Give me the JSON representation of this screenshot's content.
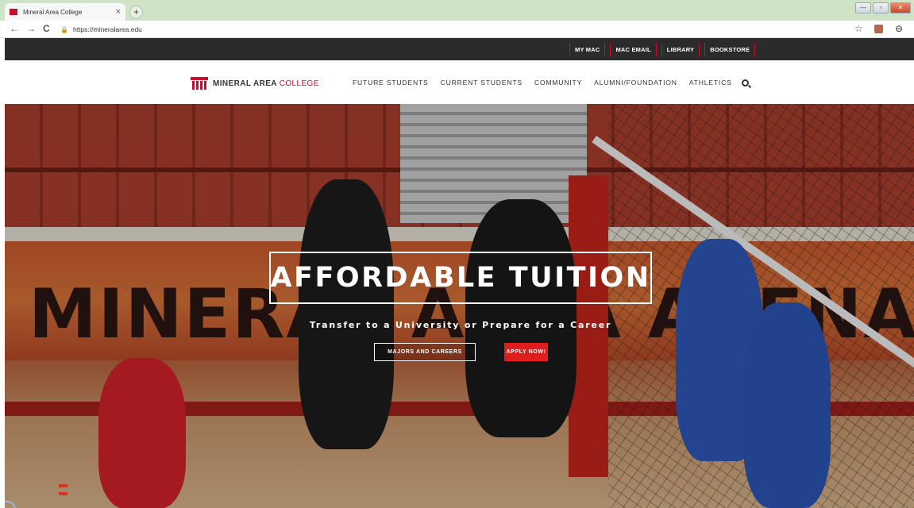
{
  "browser": {
    "tab_title": "Mineral Area College",
    "tab_close": "×",
    "new_tab": "+",
    "url": "https://mineralarea.edu",
    "back": "←",
    "forward": "→",
    "reload": "C",
    "lock": "🔒",
    "star": "☆",
    "account": "⊖",
    "window_min": "—",
    "window_max": "▫",
    "window_close": "✕"
  },
  "utility_nav": {
    "items": [
      "MY MAC",
      "MAC EMAIL",
      "LIBRARY",
      "BOOKSTORE"
    ]
  },
  "header": {
    "logo_primary": "MINERAL AREA",
    "logo_accent": "COLLEGE",
    "nav": [
      "FUTURE STUDENTS",
      "CURRENT STUDENTS",
      "COMMUNITY",
      "ALUMNI/FOUNDATION",
      "ATHLETICS"
    ]
  },
  "hero": {
    "background_text": "MINERAL AREA ARENA",
    "title": "AFFORDABLE TUITION",
    "subtitle": "Transfer to a University or Prepare for a Career",
    "buttons": {
      "majors": "MAJORS AND CAREERS",
      "apply": "APPLY NOW!"
    }
  },
  "colors": {
    "brand_red": "#c8102e",
    "apply_red": "#e01d1d",
    "utility_bg": "#2b2b2b"
  }
}
